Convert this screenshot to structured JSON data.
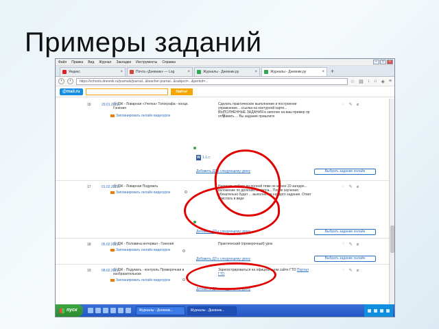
{
  "slide": {
    "title": "Примеры заданий"
  },
  "menubar": {
    "items": [
      "Файл",
      "Правка",
      "Вид",
      "Журнал",
      "Закладки",
      "Инструменты",
      "Справка"
    ]
  },
  "tabs": [
    {
      "label": "Яндекс",
      "favicon_color": "#e02020",
      "active": false
    },
    {
      "label": "Почта «Дневник» — Log",
      "favicon_color": "#d44638",
      "active": false
    },
    {
      "label": "Журналы - Дневник.ру",
      "favicon_color": "#2fa84f",
      "active": false
    },
    {
      "label": "Журналы - Дневник.ру",
      "favicon_color": "#2fa84f",
      "active": true
    }
  ],
  "navbar": {
    "url": "https://schools.dnevnik.ru/journals/journal...&teacher-journal...&subject=...&period=...",
    "icons": [
      "star-icon",
      "bookmark-icon",
      "download-icon",
      "home-icon",
      "shield-icon",
      "menu-icon"
    ]
  },
  "mailbar": {
    "logo": "@mail.ru",
    "search_value": "",
    "button": "Найти!"
  },
  "rows": [
    {
      "num": "16",
      "date": "29.01.2021",
      "lesson": "Ⓢ ДЖ - Ловарная «Учетка» Топографа - конце. Гонения",
      "video": "Запланировать онлайн видеоурок",
      "task": "Сделать практическое выполнение и построение упражнение... ссылка на контурной карте... ВЫПОЛНЕННЫЕ ЗАДАНИЯ в заполне на ваш пример пр отправить ... Вы задание пришлите",
      "attachment": "1.1.c",
      "bottom_link": "Добавить ДЗ к следующему уроку",
      "choose": "Выбрать задание онлайн"
    },
    {
      "num": "17",
      "date": "01.02.2021",
      "lesson": "Ⓢ ДЖ - Ловарная Подумать",
      "video": "Запланировать онлайн видеоурок",
      "task": "Написать работу по полной теме не менее 20 загадок... изложение по делению вопроса... После изучения обязательно будет ... выполнение каждого задания. Ответ прислать в виде",
      "attachment": "",
      "bottom_link": "Добавить ДЗ к следующему уроку",
      "choose": "Выбрать задание онлайн"
    },
    {
      "num": "18",
      "date": "05.02.2021",
      "lesson": "Ⓢ ДЖ - Половина интервал - Гонения",
      "video": "Запланировать онлайн видеоурок",
      "task": "Практический (проверочный) урок",
      "attachment": "",
      "bottom_link": "Добавить ДЗ к следующему уроку",
      "choose": "Выбрать задание онлайн"
    },
    {
      "num": "19",
      "date": "08.02.2021",
      "lesson": "Ⓢ ДЖ - Подумать - контроль Проверочная в изобразительном",
      "video": "Запланировать онлайн видеоурок",
      "task_prefix": "Зарегистрироваться на официальном сайте ГТО ",
      "task_link": "Портал ГТО",
      "attachment": "",
      "bottom_link": "Добавить ДЗ к следующему уроку",
      "choose": ""
    }
  ],
  "taskbar": {
    "start": "пуск",
    "items": [
      {
        "label": "Журналы - Дневник...",
        "active": false
      },
      {
        "label": "Журналы - Дневник...",
        "active": true
      }
    ]
  },
  "colors": {
    "link": "#2a6ebb",
    "oval": "#e00000",
    "taskbar": "#2456c4",
    "mail_accent": "#f7a600"
  }
}
